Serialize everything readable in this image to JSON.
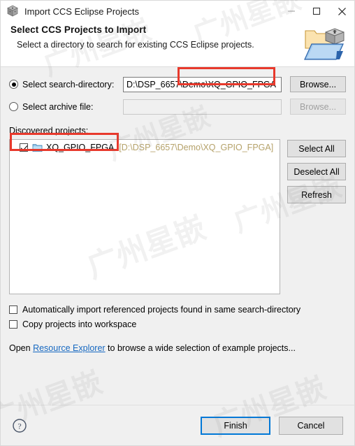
{
  "window": {
    "title": "Import CCS Eclipse Projects",
    "icon": "ccs-cube-icon",
    "minimize_label": "—",
    "maximize_label": "□",
    "close_label": "✕"
  },
  "header": {
    "title": "Select CCS Projects to Import",
    "subtitle": "Select a directory to search for existing CCS Eclipse projects.",
    "icon": "import-projects-icon"
  },
  "source": {
    "search_directory": {
      "label": "Select search-directory:",
      "selected": true,
      "value": "D:\\DSP_6657\\Demo\\XQ_GPIO_FPGA",
      "browse_label": "Browse..."
    },
    "archive_file": {
      "label": "Select archive file:",
      "selected": false,
      "value": "",
      "browse_label": "Browse...",
      "browse_disabled": true
    }
  },
  "discovered": {
    "label": "Discovered projects:",
    "projects": [
      {
        "checked": true,
        "name": "XQ_GPIO_FPGA",
        "path": "[D:\\DSP_6657\\Demo\\XQ_GPIO_FPGA]",
        "icon": "folder-icon"
      }
    ],
    "buttons": [
      {
        "label": "Select All",
        "name": "select-all-button"
      },
      {
        "label": "Deselect All",
        "name": "deselect-all-button"
      },
      {
        "label": "Refresh",
        "name": "refresh-button"
      }
    ]
  },
  "options": {
    "auto_import": {
      "label": "Automatically import referenced projects found in same search-directory",
      "checked": false
    },
    "copy_into_workspace": {
      "label": "Copy projects into workspace",
      "checked": false
    }
  },
  "resource_hint": {
    "prefix": "Open ",
    "link": "Resource Explorer",
    "suffix": " to browse a wide selection of example projects..."
  },
  "footer": {
    "help_icon": "help-icon",
    "finish_label": "Finish",
    "cancel_label": "Cancel"
  },
  "watermark": {
    "text": "广州星嵌"
  },
  "colors": {
    "accent": "#0078D7",
    "annotation": "#E8392C",
    "link": "#1668C1",
    "path_text": "#B5A26A",
    "dialog_bg": "#F0F0F0"
  }
}
